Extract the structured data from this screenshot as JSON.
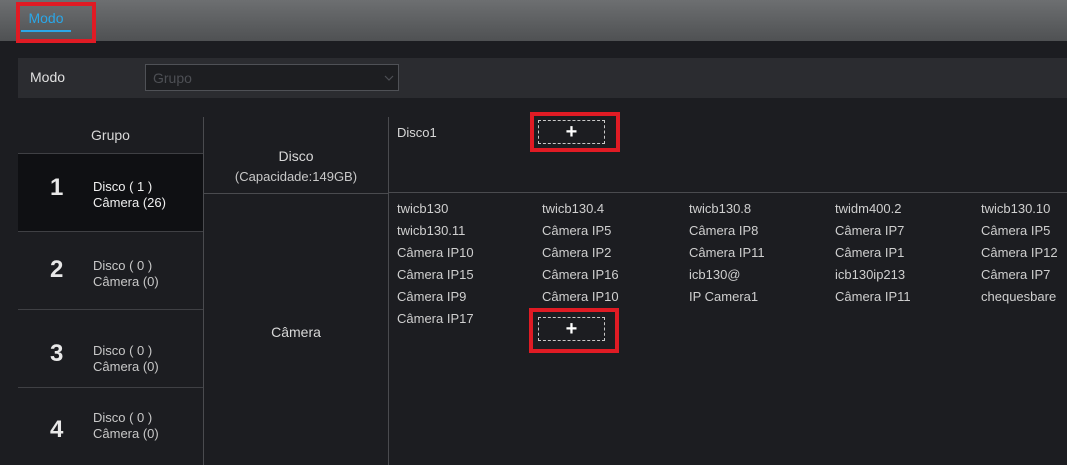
{
  "tabs": [
    {
      "label": "Modo"
    }
  ],
  "mode": {
    "label": "Modo",
    "value": "Grupo"
  },
  "groups": {
    "header": "Grupo",
    "items": [
      {
        "number": "1",
        "disk": "Disco ( 1 )",
        "camera": "Câmera (26)"
      },
      {
        "number": "2",
        "disk": "Disco ( 0 )",
        "camera": "Câmera (0)"
      },
      {
        "number": "3",
        "disk": "Disco ( 0 )",
        "camera": "Câmera (0)"
      },
      {
        "number": "4",
        "disk": "Disco ( 0 )",
        "camera": "Câmera (0)"
      }
    ]
  },
  "disk_section": {
    "title": "Disco",
    "capacity": "(Capacidade:149GB)",
    "disks": [
      "Disco1"
    ],
    "add_label": "+"
  },
  "camera_section": {
    "title": "Câmera",
    "add_label": "+",
    "rows": [
      [
        "twicb130",
        "twicb130.4",
        "twicb130.8",
        "twidm400.2",
        "twicb130.10"
      ],
      [
        "twicb130.11",
        "Câmera IP5",
        "Câmera IP8",
        "Câmera IP7",
        "Câmera IP5"
      ],
      [
        "Câmera IP10",
        "Câmera IP2",
        "Câmera IP11",
        "Câmera IP1",
        "Câmera IP12"
      ],
      [
        "Câmera IP15",
        "Câmera IP16",
        "icb130@",
        "icb130ip213",
        "Câmera IP7"
      ],
      [
        "Câmera IP9",
        "Câmera IP10",
        "IP Camera1",
        "Câmera IP11",
        "chequesbare"
      ],
      [
        "Câmera IP17"
      ]
    ]
  },
  "colors": {
    "accent": "#2aa7e8",
    "highlight": "#e01b24",
    "background": "#1c1d21"
  }
}
